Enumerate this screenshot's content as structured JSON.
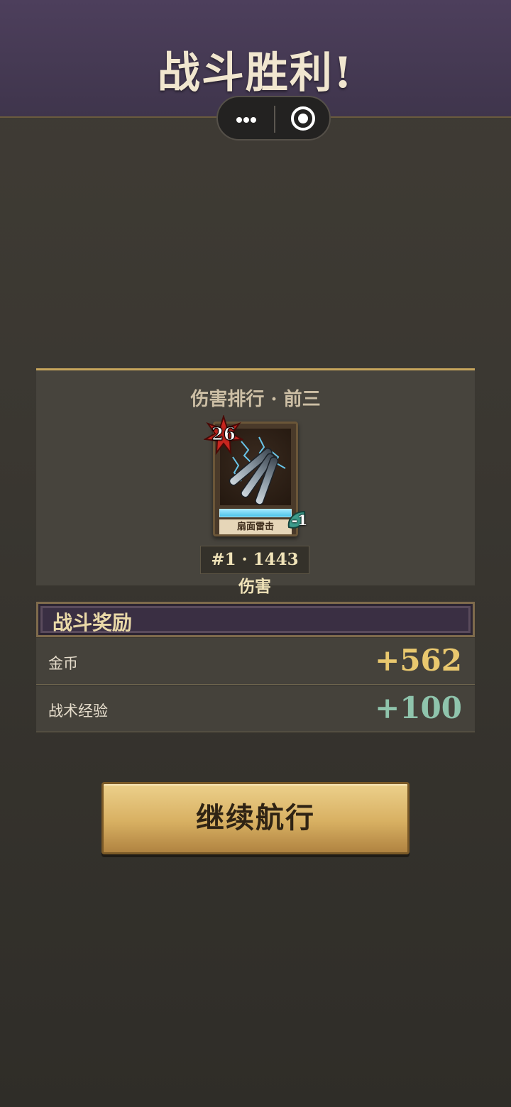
{
  "header": {
    "title": "战斗胜利!"
  },
  "capsule": {
    "more_icon": "more-dots-icon",
    "close_icon": "target-icon"
  },
  "ranking": {
    "title": "伤害排行 · 前三",
    "card": {
      "cost": "26",
      "name": "扇面雷击",
      "badge": "-1",
      "art_icon": "torpedo-spread-icon"
    },
    "line": "#1 · 1443 伤害"
  },
  "rewards": {
    "header": "战斗奖励",
    "items": [
      {
        "label": "金币",
        "value": "+562",
        "color": "#e9c86e"
      },
      {
        "label": "战术经验",
        "value": "+100",
        "color": "#8fc4ac"
      }
    ]
  },
  "actions": {
    "continue_label": "继续航行"
  }
}
